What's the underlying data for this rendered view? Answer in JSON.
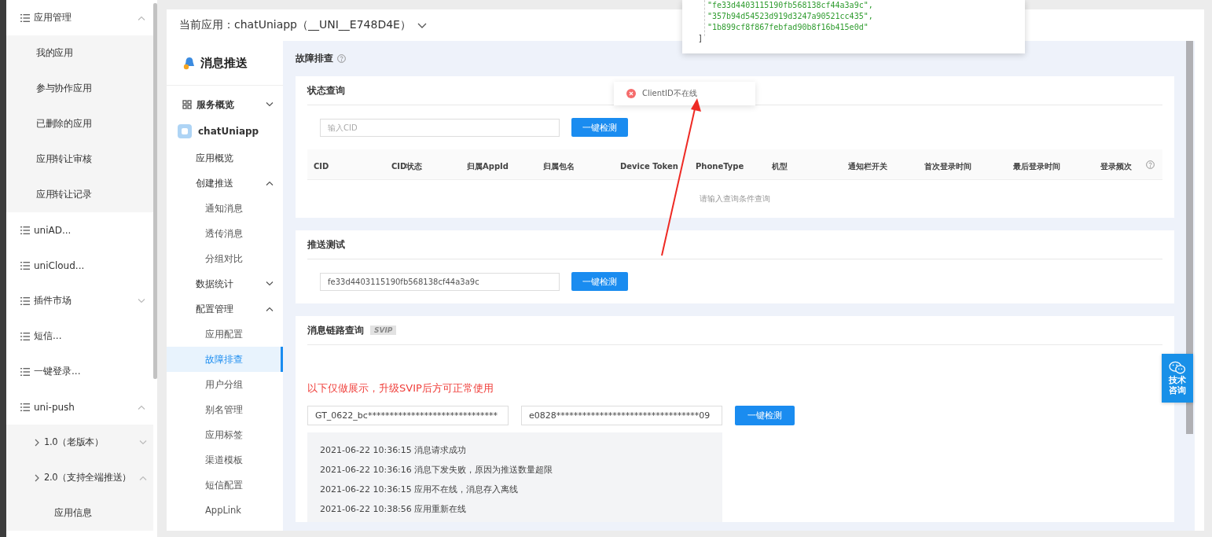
{
  "left_nav": [
    {
      "label": "应用管理",
      "expanded": true,
      "children": [
        {
          "label": "我的应用"
        },
        {
          "label": "参与协作应用"
        },
        {
          "label": "已删除的应用"
        },
        {
          "label": "应用转让审核"
        },
        {
          "label": "应用转让记录"
        }
      ]
    },
    {
      "label": "uniAD..."
    },
    {
      "label": "uniCloud..."
    },
    {
      "label": "插件市场",
      "expanded": false
    },
    {
      "label": "短信..."
    },
    {
      "label": "一键登录..."
    },
    {
      "label": "uni-push",
      "expanded": true,
      "children": [
        {
          "label": "1.0（老版本）",
          "expanded": false
        },
        {
          "label": "2.0（支持全端推送）",
          "expanded": true,
          "children": [
            {
              "label": "应用信息"
            }
          ]
        }
      ]
    }
  ],
  "current_app": {
    "text": "当前应用：chatUniapp（__UNI__E748D4E）"
  },
  "product": {
    "title": "消息推送"
  },
  "side_menu": [
    {
      "label": "服务概览",
      "kind": "group",
      "expanded": false
    },
    {
      "label": "chatUniapp",
      "kind": "app"
    },
    {
      "label": "应用概览",
      "kind": "item",
      "selected": false
    },
    {
      "label": "创建推送",
      "kind": "item",
      "expanded": true,
      "children": [
        {
          "label": "通知消息",
          "selected": false
        },
        {
          "label": "透传消息",
          "selected": false
        },
        {
          "label": "分组对比",
          "selected": false
        }
      ]
    },
    {
      "label": "数据统计",
      "kind": "item",
      "expanded": false
    },
    {
      "label": "配置管理",
      "kind": "item",
      "expanded": true,
      "children": [
        {
          "label": "应用配置",
          "selected": false
        },
        {
          "label": "故障排查",
          "selected": true
        },
        {
          "label": "用户分组",
          "selected": false
        },
        {
          "label": "别名管理",
          "selected": false
        },
        {
          "label": "应用标签",
          "selected": false
        },
        {
          "label": "渠道模板",
          "selected": false
        },
        {
          "label": "短信配置",
          "selected": false
        },
        {
          "label": "AppLink",
          "selected": false
        }
      ]
    }
  ],
  "page_title": "故障排查",
  "status_query": {
    "title": "状态查询",
    "placeholder": "输入CID",
    "button": "一键检测",
    "columns": [
      "CID",
      "CID状态",
      "归属AppId",
      "归属包名",
      "Device Token",
      "PhoneType",
      "机型",
      "通知栏开关",
      "首次登录时间",
      "最后登录时间",
      "登录频次"
    ],
    "empty_text": "请输入查询条件查询"
  },
  "push_test": {
    "title": "推送测试",
    "value": "fe33d4403115190fb568138cf44a3a9c",
    "button": "一键检测"
  },
  "trace": {
    "title": "消息链路查询",
    "badge": "SVIP",
    "notice": "以下仅做展示，升级SVIP后方可正常使用",
    "value_1": "GT_0622_bc******************************",
    "value_2": "e0828*********************************09",
    "button": "一键检测",
    "logs": [
      "2021-06-22 10:36:15 消息请求成功",
      "2021-06-22 10:36:16 消息下发失败，原因为推送数量超限",
      "2021-06-22 10:36:15 应用不在线，消息存入离线",
      "2021-06-22 10:38:56 应用重新在线"
    ]
  },
  "float_button": "技术咨询",
  "toast": {
    "message": "ClientID不在线"
  },
  "code_popup": {
    "lines": [
      {
        "text": "\"fe33d4403115190fb568138cf44a3a9c\",",
        "kind": "string"
      },
      {
        "text": "\"357b94d54523d919d3247a90521cc435\",",
        "kind": "string"
      },
      {
        "text": "\"1b899cf8f867febfad90b8f16b415e0d\"",
        "kind": "string"
      },
      {
        "text": "]",
        "kind": "punct"
      }
    ]
  }
}
